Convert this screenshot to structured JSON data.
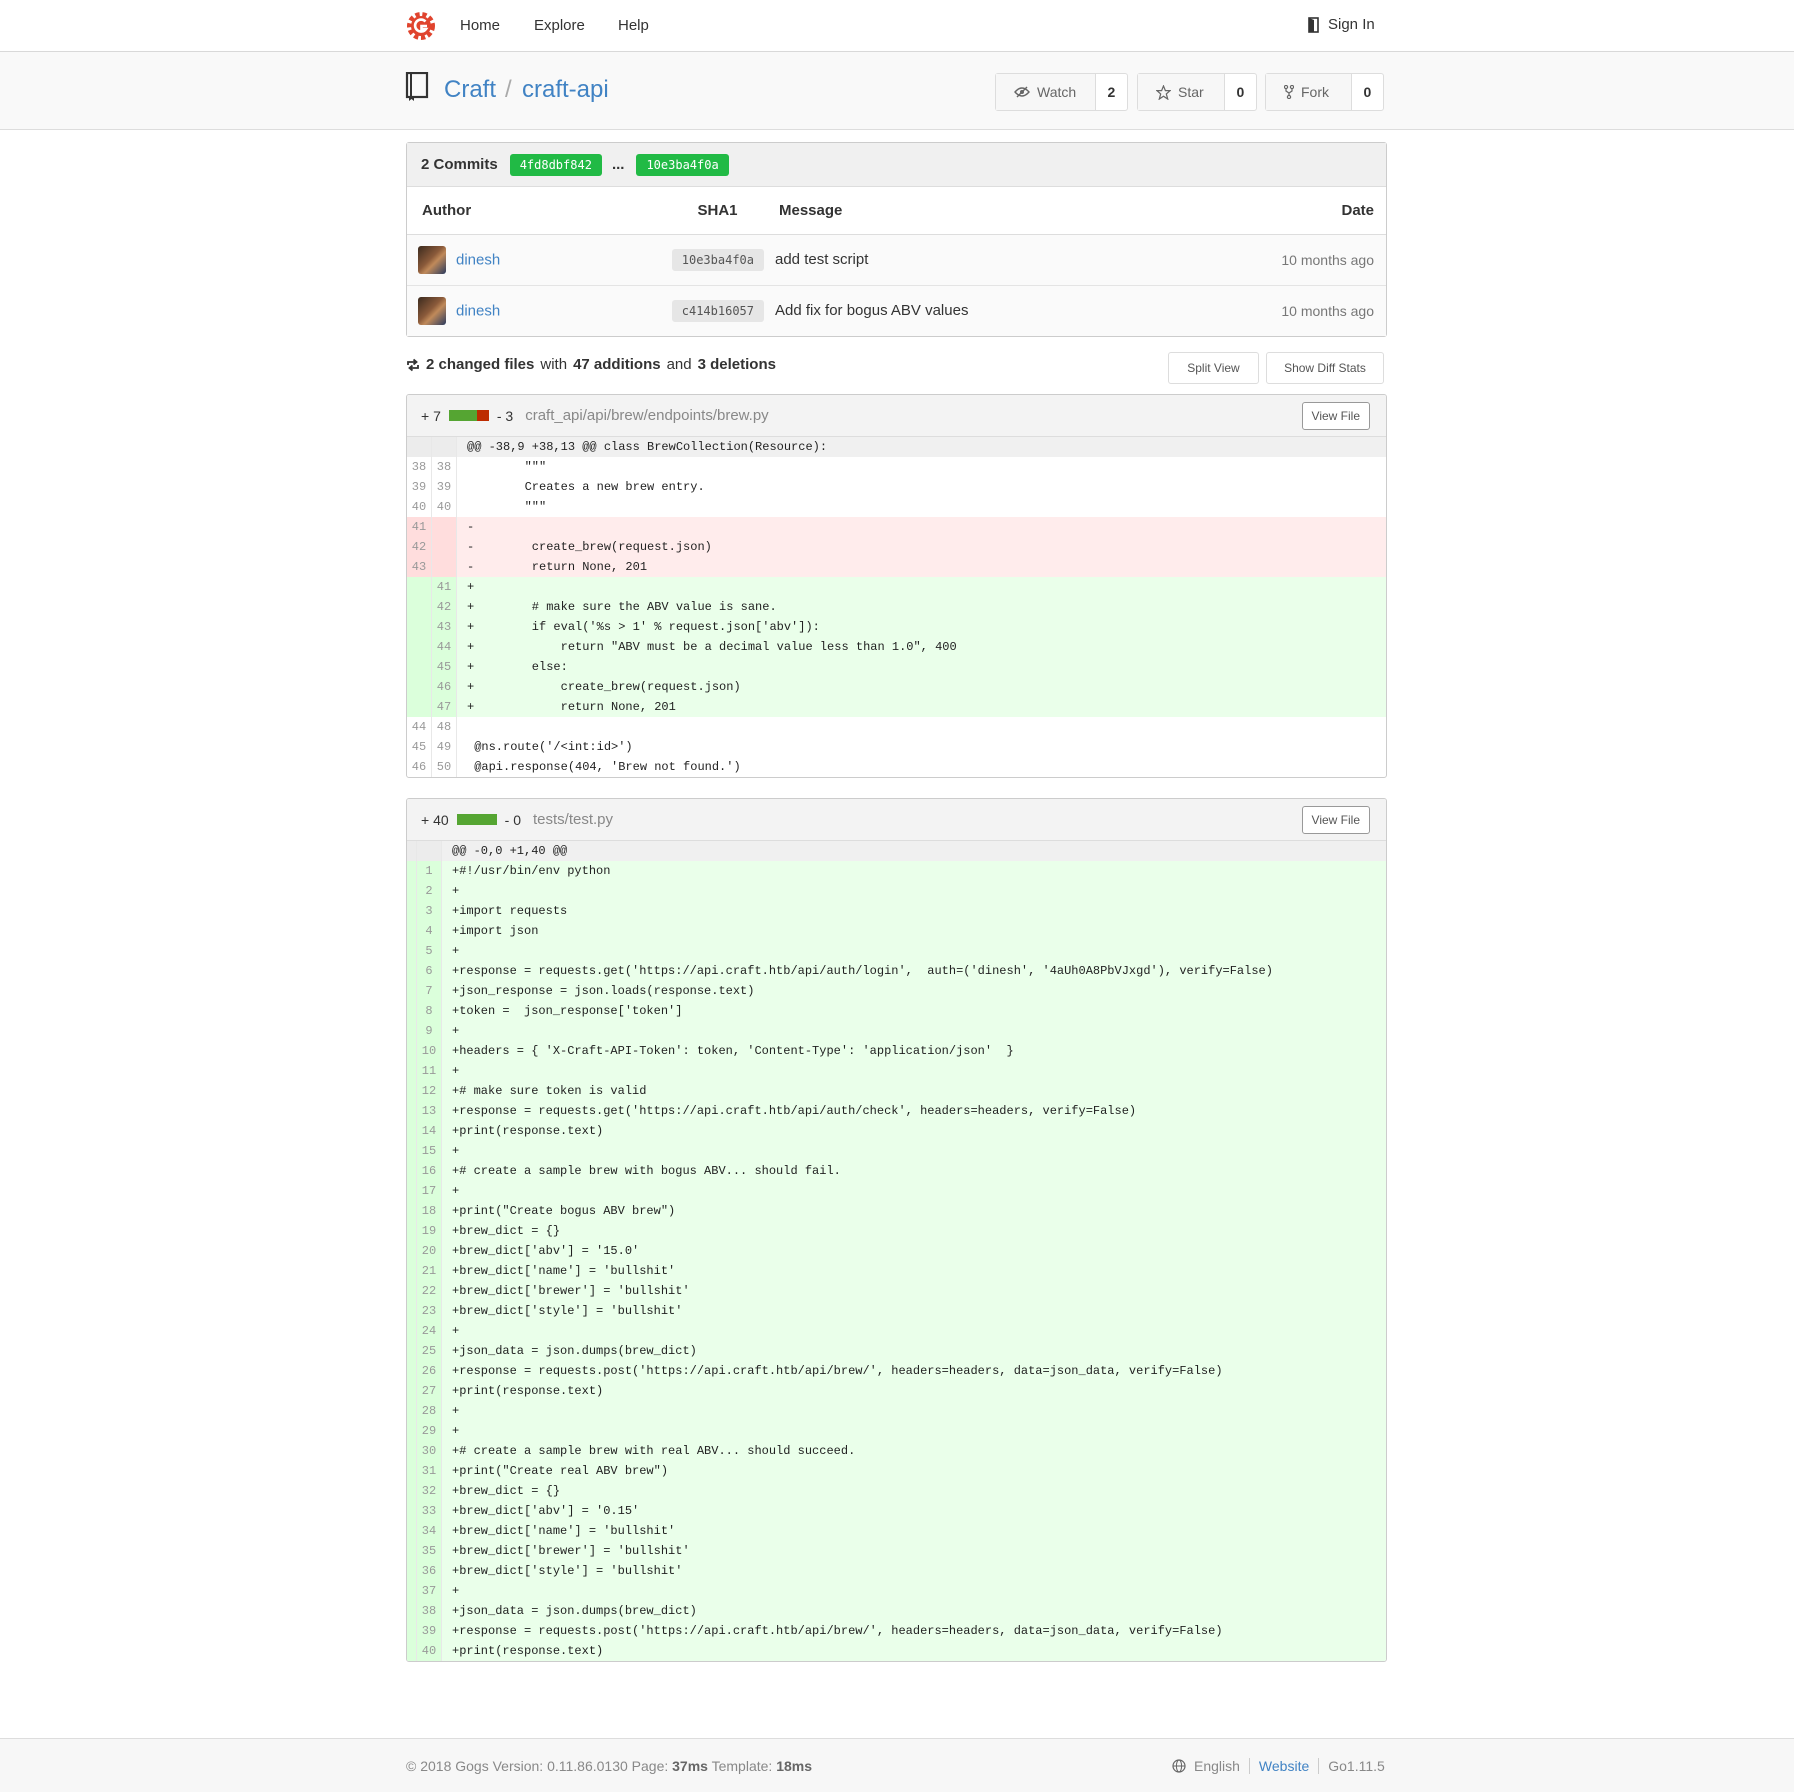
{
  "nav": {
    "home": "Home",
    "explore": "Explore",
    "help": "Help",
    "sign_in": "Sign In"
  },
  "repo": {
    "owner": "Craft",
    "separator": "/",
    "name": "craft-api",
    "watch": {
      "label": "Watch",
      "count": "2"
    },
    "star": {
      "label": "Star",
      "count": "0"
    },
    "fork": {
      "label": "Fork",
      "count": "0"
    }
  },
  "commits": {
    "title": "2 Commits",
    "from_sha": "4fd8dbf842",
    "dots": "...",
    "to_sha": "10e3ba4f0a",
    "columns": {
      "author": "Author",
      "sha": "SHA1",
      "message": "Message",
      "date": "Date"
    },
    "rows": [
      {
        "author": "dinesh",
        "sha": "10e3ba4f0a",
        "message": "add test script",
        "date": "10 months ago"
      },
      {
        "author": "dinesh",
        "sha": "c414b16057",
        "message": "Add fix for bogus ABV values",
        "date": "10 months ago"
      }
    ]
  },
  "diff_summary": {
    "changed": "2 changed files",
    "with": "with",
    "additions": "47 additions",
    "and": "and",
    "deletions": "3 deletions",
    "split_view": "Split View",
    "show_stats": "Show Diff Stats"
  },
  "files": [
    {
      "additions": "+ 7",
      "deletions": "- 3",
      "add_fraction": 0.7,
      "path": "craft_api/api/brew/endpoints/brew.py",
      "view_file": "View File",
      "hunk": "@@ -38,9 +38,13 @@ class BrewCollection(Resource):",
      "lines": [
        {
          "type": "ctx",
          "old": "38",
          "new": "38",
          "text": "        \"\"\""
        },
        {
          "type": "ctx",
          "old": "39",
          "new": "39",
          "text": "        Creates a new brew entry."
        },
        {
          "type": "ctx",
          "old": "40",
          "new": "40",
          "text": "        \"\"\""
        },
        {
          "type": "del",
          "old": "41",
          "new": "",
          "text": "-"
        },
        {
          "type": "del",
          "old": "42",
          "new": "",
          "text": "-        create_brew(request.json)"
        },
        {
          "type": "del",
          "old": "43",
          "new": "",
          "text": "-        return None, 201"
        },
        {
          "type": "add",
          "old": "",
          "new": "41",
          "text": "+"
        },
        {
          "type": "add",
          "old": "",
          "new": "42",
          "text": "+        # make sure the ABV value is sane."
        },
        {
          "type": "add",
          "old": "",
          "new": "43",
          "text": "+        if eval('%s > 1' % request.json['abv']):"
        },
        {
          "type": "add",
          "old": "",
          "new": "44",
          "text": "+            return \"ABV must be a decimal value less than 1.0\", 400"
        },
        {
          "type": "add",
          "old": "",
          "new": "45",
          "text": "+        else:"
        },
        {
          "type": "add",
          "old": "",
          "new": "46",
          "text": "+            create_brew(request.json)"
        },
        {
          "type": "add",
          "old": "",
          "new": "47",
          "text": "+            return None, 201"
        },
        {
          "type": "ctx",
          "old": "44",
          "new": "48",
          "text": ""
        },
        {
          "type": "ctx",
          "old": "45",
          "new": "49",
          "text": " @ns.route('/<int:id>')"
        },
        {
          "type": "ctx",
          "old": "46",
          "new": "50",
          "text": " @api.response(404, 'Brew not found.')"
        }
      ]
    },
    {
      "additions": "+ 40",
      "deletions": "- 0",
      "add_fraction": 1.0,
      "path": "tests/test.py",
      "view_file": "View File",
      "hunk": "@@ -0,0 +1,40 @@",
      "lines": [
        "+#!/usr/bin/env python",
        "+",
        "+import requests",
        "+import json",
        "+",
        "+response = requests.get('https://api.craft.htb/api/auth/login',  auth=('dinesh', '4aUh0A8PbVJxgd'), verify=False)",
        "+json_response = json.loads(response.text)",
        "+token =  json_response['token']",
        "+",
        "+headers = { 'X-Craft-API-Token': token, 'Content-Type': 'application/json'  }",
        "+",
        "+# make sure token is valid",
        "+response = requests.get('https://api.craft.htb/api/auth/check', headers=headers, verify=False)",
        "+print(response.text)",
        "+",
        "+# create a sample brew with bogus ABV... should fail.",
        "+",
        "+print(\"Create bogus ABV brew\")",
        "+brew_dict = {}",
        "+brew_dict['abv'] = '15.0'",
        "+brew_dict['name'] = 'bullshit'",
        "+brew_dict['brewer'] = 'bullshit'",
        "+brew_dict['style'] = 'bullshit'",
        "+",
        "+json_data = json.dumps(brew_dict)",
        "+response = requests.post('https://api.craft.htb/api/brew/', headers=headers, data=json_data, verify=False)",
        "+print(response.text)",
        "+",
        "+",
        "+# create a sample brew with real ABV... should succeed.",
        "+print(\"Create real ABV brew\")",
        "+brew_dict = {}",
        "+brew_dict['abv'] = '0.15'",
        "+brew_dict['name'] = 'bullshit'",
        "+brew_dict['brewer'] = 'bullshit'",
        "+brew_dict['style'] = 'bullshit'",
        "+",
        "+json_data = json.dumps(brew_dict)",
        "+response = requests.post('https://api.craft.htb/api/brew/', headers=headers, data=json_data, verify=False)",
        "+print(response.text)"
      ]
    }
  ],
  "footer": {
    "copyright": "© 2018 Gogs Version: 0.11.86.0130 Page:",
    "page_time": "37ms",
    "template_label": "Template:",
    "template_time": "18ms",
    "language": "English",
    "website": "Website",
    "go_version": "Go1.11.5"
  },
  "colors": {
    "accent": "#4183c4",
    "badge": "#21ba45",
    "add_bg": "#eaffea",
    "del_bg": "#ffecec",
    "logo": "#e0442e"
  }
}
